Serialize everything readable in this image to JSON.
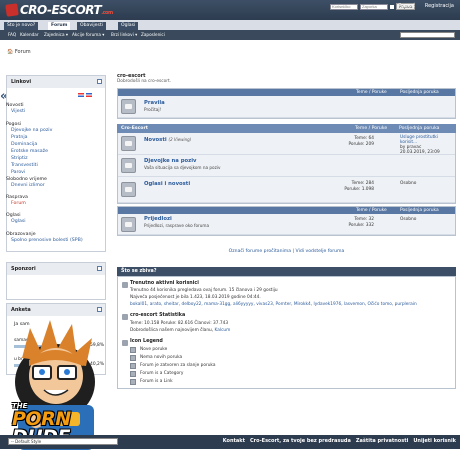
{
  "header": {
    "logo_text": "CRO-ESCORT",
    "logo_suffix": ".com",
    "login_username_placeholder": "Korisničko",
    "login_password_placeholder": "Zaporka",
    "login_button": "Prijava",
    "help_link": "Pomoć",
    "register_link": "Registracija"
  },
  "nav_tabs": [
    "Što je novo?",
    "Forum",
    "Obavijesti",
    "Oglasi"
  ],
  "subnav": [
    "FAQ",
    "Kalendar",
    "Zajednica ▾",
    "Akcije foruma ▾",
    "Brzi linkovi ▾",
    "Zaposlenici"
  ],
  "subnav_search_placeholder": "",
  "breadcrumb": "Forum",
  "sidebar": {
    "links_title": "Linkovi",
    "sections": [
      {
        "title": "Novosti",
        "links": [
          "Vijesti"
        ]
      },
      {
        "title": "Pogosi",
        "links": [
          "Djevojke na poziv",
          "Pratnja",
          "Dominacija",
          "Erotske masaže",
          "Striptiz",
          "Transvestiti",
          "Parovi"
        ]
      },
      {
        "title": "Slobodno vrijeme",
        "links": [
          "Dnevni izlimor"
        ]
      },
      {
        "title": "Rasprava",
        "links": [
          "Forum"
        ]
      },
      {
        "title": "Oglasi",
        "links": [
          "Oglasi"
        ]
      },
      {
        "title": "Obrazovanje",
        "links": [
          "Spolno prenosive bolesti (SPB)"
        ]
      }
    ],
    "sponsors_title": "Sponzori",
    "poll_title": "Anketa",
    "poll_question": "Ja sam",
    "poll_options": [
      {
        "label": "samac",
        "percent": "59,8%",
        "value": 59.8
      },
      {
        "label": "u braku",
        "percent": "40,2%",
        "value": 40.2
      }
    ]
  },
  "main": {
    "title": "cro-escort",
    "subtitle": "Dobrodošli na cro-escort.",
    "col_threads": "Teme / Poruke",
    "col_last": "Posljednja poruka",
    "categories": [
      {
        "name": "",
        "forums": [
          {
            "title": "Pravila",
            "desc": "Pročitaj!",
            "stats": "",
            "last": ""
          }
        ]
      },
      {
        "name": "Cro-Escort",
        "forums": [
          {
            "title": "Novosti",
            "viewing": "(2 Viewing)",
            "desc": "",
            "stats": [
              "Teme: 64",
              "Poruke: 209"
            ],
            "last": [
              "Usluge prostitutki korisit...",
              "by pravac",
              "20.03.2019, 23:09"
            ]
          },
          {
            "title": "Djevojke na poziv",
            "desc": "Vaša situacija sa djevojkom na poziv",
            "stats": "",
            "last": ""
          },
          {
            "title": "Oglasi i novosti",
            "desc": "",
            "stats": [
              "Teme: 284",
              "Poruke: 1.098"
            ],
            "last": [
              "Osobno"
            ]
          }
        ]
      },
      {
        "name": "",
        "forums": [
          {
            "title": "Prijedlozi",
            "desc": "Prijedlozi, rasprave oko foruma",
            "stats": [
              "Teme: 32",
              "Poruke: 332"
            ],
            "last": [
              "Osobno"
            ]
          }
        ]
      }
    ],
    "mark_read": "Označi forume pročitanima | Vidi vodstelje foruma",
    "whos_on_title": "Što se zbiva?",
    "online_title": "Trenutno aktivni korisnici",
    "online_line1": "Trenutno 44 korisnika pregledava ovaj forum. 15 članova i 29 gostiju",
    "online_line2": "Najveća posjećenost je bila 1.423, 18.03.2019 godine 04:44.",
    "online_users": "bokal01, arato, sheitar, delboy22, mama-31gg, ali6yyyyy, vivas23, Pornter, Mirokk4, lydavek1976, lasvemon, Očićo tomo, purplerain",
    "stats_title": "cro-escort Statistika",
    "stats_line1": "Teme: 10.158   Poruke: 82.616   Članovi: 37.743",
    "stats_line2": "Dobrodošlica našem najnovijem članu, ",
    "stats_newest": "Kalcum",
    "legend_title": "Icon Legend",
    "legend": [
      "Nove poruke",
      "Nema novih poruka",
      "Forum je zatvoren za slanje poruka",
      "Forum is a Category",
      "Forum is a Link"
    ]
  },
  "footer": {
    "style_select": "-- Default Style",
    "links": [
      "Kontakt",
      "Cro-Escort, za tvoje bez predrasuda",
      "Zaštita privatnosti",
      "Unijeti korisnik"
    ]
  },
  "promo": {
    "the": "THE",
    "porn": "PORN",
    "dude": "DUDE"
  }
}
